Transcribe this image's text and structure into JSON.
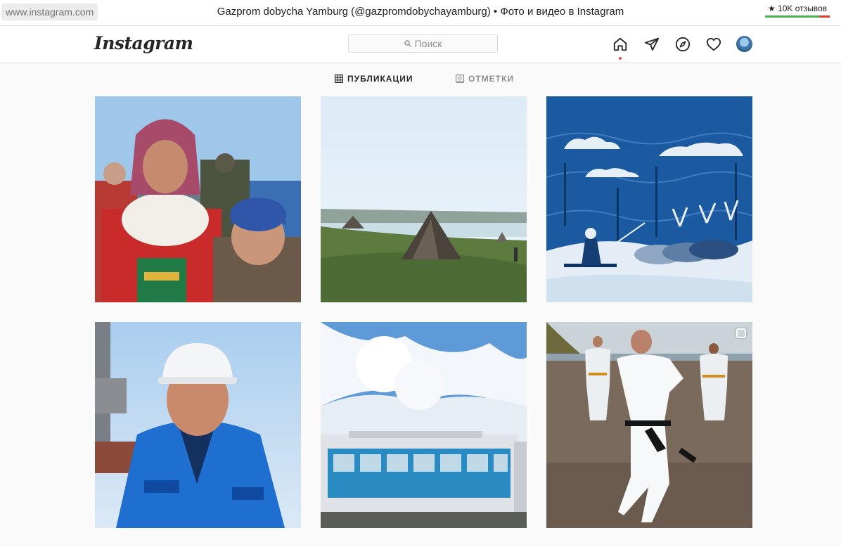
{
  "browser": {
    "url": "www.instagram.com",
    "title": "Gazprom dobycha Yamburg (@gazpromdobychayamburg) • Фото и видео в Instagram",
    "reviews_label": "★ 10K отзывов"
  },
  "header": {
    "logo_text": "Instagram",
    "search_placeholder": "Поиск",
    "icons": [
      "home-icon",
      "direct-icon",
      "explore-icon",
      "activity-heart-icon",
      "profile-avatar"
    ]
  },
  "tabs": [
    {
      "label": "ПУБЛИКАЦИИ",
      "icon": "grid-icon",
      "active": true
    },
    {
      "label": "ОТМЕТКИ",
      "icon": "tagged-icon",
      "active": false
    }
  ],
  "posts": [
    {
      "subject": "nenets-children",
      "multi": false
    },
    {
      "subject": "tundra-chum-tents",
      "multi": false
    },
    {
      "subject": "reindeer-sled-illustration",
      "multi": false
    },
    {
      "subject": "gazprom-worker-portrait",
      "multi": false
    },
    {
      "subject": "sports-complex-building",
      "multi": false
    },
    {
      "subject": "karate-on-beach",
      "multi": true
    }
  ],
  "colors": {
    "accent": "#ed4956",
    "tab_active": "#262626",
    "tab_inactive": "#8e8e8e",
    "reviews_green": "#4caf50",
    "reviews_red": "#e53935"
  }
}
